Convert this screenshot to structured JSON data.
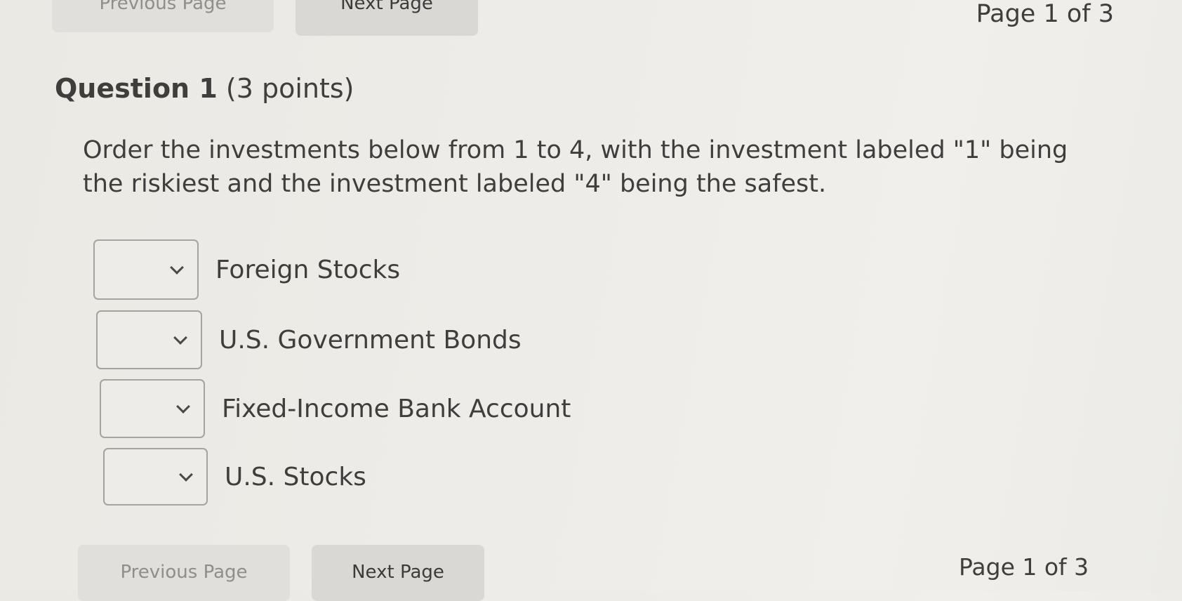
{
  "navigation": {
    "previous_label": "Previous Page",
    "next_label": "Next Page",
    "page_indicator": "Page 1 of 3"
  },
  "question": {
    "title": "Question 1",
    "points": "(3 points)",
    "prompt": "Order the investments below from 1 to 4, with the investment labeled \"1\" being the riskiest and the investment labeled \"4\" being the safest.",
    "items": [
      {
        "selected": "",
        "label": "Foreign Stocks"
      },
      {
        "selected": "",
        "label": "U.S. Government Bonds"
      },
      {
        "selected": "",
        "label": "Fixed-Income Bank Account"
      },
      {
        "selected": "",
        "label": "U.S. Stocks"
      }
    ]
  },
  "icons": {
    "dropdown": "chevron-down-icon"
  },
  "colors": {
    "background": "#eeece8",
    "button_bg": "#d9d8d5",
    "text": "#3f3e3c",
    "border": "#a4a39f"
  }
}
